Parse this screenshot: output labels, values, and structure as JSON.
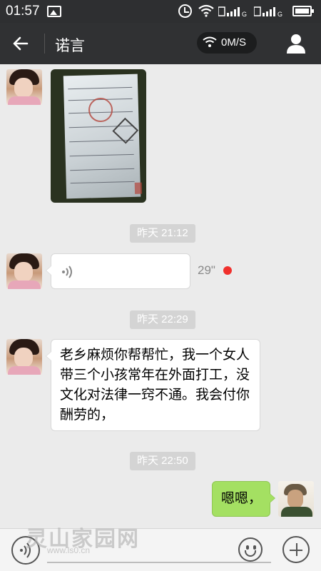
{
  "status_bar": {
    "time": "01:57",
    "sim1_label": "G",
    "sim2_label": "G"
  },
  "header": {
    "title": "诺言",
    "network_speed": "0M/S"
  },
  "messages": {
    "ts1": "昨天 21:12",
    "voice_duration": "29\"",
    "ts2": "昨天 22:29",
    "text_1": "老乡麻烦你帮帮忙，我一个女人带三个小孩常年在外面打工，没文化对法律一窍不通。我会付你酬劳的，",
    "ts3": "昨天 22:50",
    "my_reply": "嗯嗯，"
  },
  "watermark": {
    "name": "灵山家园网",
    "url": "www.ls0.cn"
  },
  "colors": {
    "header_bg": "#303133",
    "chat_bg": "#ebebeb",
    "my_bubble": "#a4e062",
    "unread_dot": "#f0302c"
  }
}
